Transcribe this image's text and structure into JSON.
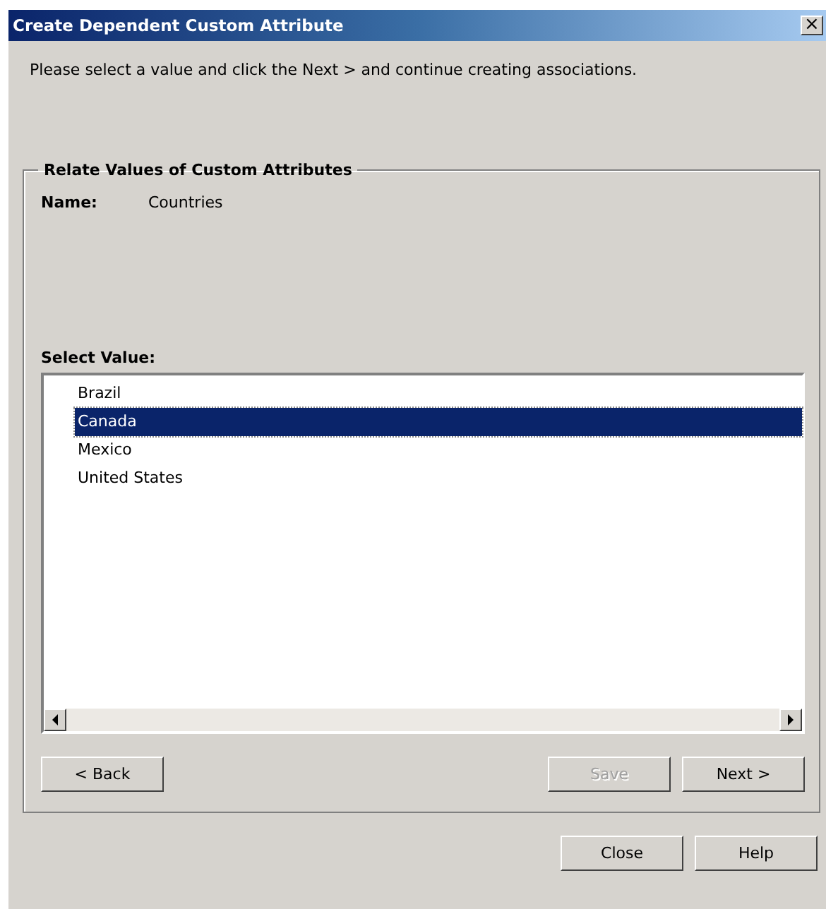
{
  "window": {
    "title": "Create Dependent Custom Attribute",
    "close": "×"
  },
  "instruction": "Please select a value and click the Next > and continue creating associations.",
  "group": {
    "title": "Relate Values of Custom Attributes",
    "name_label": "Name:",
    "name_value": "Countries",
    "select_label": "Select Value:",
    "values": [
      {
        "label": "Brazil",
        "selected": false
      },
      {
        "label": "Canada",
        "selected": true
      },
      {
        "label": "Mexico",
        "selected": false
      },
      {
        "label": "United States",
        "selected": false
      }
    ],
    "buttons": [
      {
        "label": "< Back",
        "disabled": false,
        "kind": "left"
      },
      {
        "label": "Save",
        "disabled": true,
        "kind": "right"
      },
      {
        "label": "Next >",
        "disabled": false,
        "kind": "right"
      }
    ]
  },
  "footer_buttons": [
    {
      "label": "Close",
      "disabled": false
    },
    {
      "label": "Help",
      "disabled": false
    }
  ]
}
